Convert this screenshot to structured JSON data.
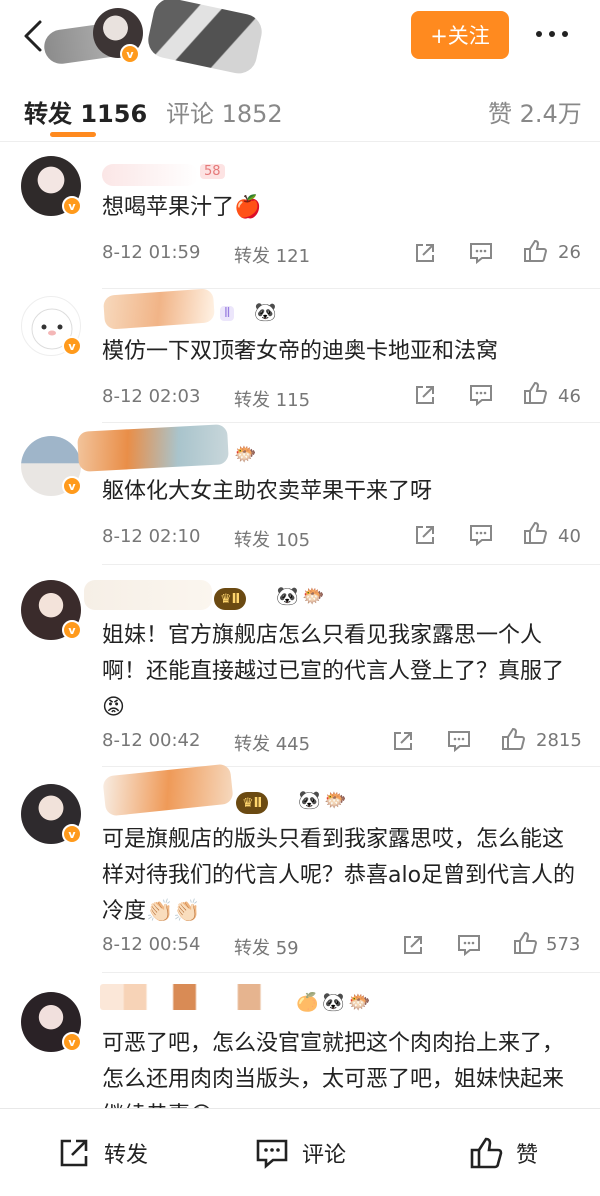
{
  "header": {
    "follow_label": "+关注"
  },
  "tabs": {
    "repost": "转发 1156",
    "comment": "评论 1852",
    "like": "赞 2.4万"
  },
  "comments": [
    {
      "badge": "58",
      "text": "想喝苹果汁了🍎",
      "time": "8-12 01:59",
      "repost": "转发 121",
      "likes": "26"
    },
    {
      "badge": "Ⅱ",
      "text": "模仿一下双顶奢女帝的迪奥卡地亚和法窝",
      "time": "8-12 02:03",
      "repost": "转发 115",
      "likes": "46"
    },
    {
      "text": "躯体化大女主助农卖苹果干来了呀",
      "time": "8-12 02:10",
      "repost": "转发 105",
      "likes": "40"
    },
    {
      "crown": "Ⅱ",
      "text": "姐妹！官方旗舰店怎么只看见我家露思一个人啊！还能直接越过已宣的代言人登上了？真服了😡",
      "time": "8-12 00:42",
      "repost": "转发 445",
      "likes": "2815"
    },
    {
      "crown": "Ⅱ",
      "text": "可是旗舰店的版头只看到我家露思哎，怎么能这样对待我们的代言人呢？恭喜alo足曾到代言人的冷度👏🏻👏🏻",
      "time": "8-12 00:54",
      "repost": "转发 59",
      "likes": "573"
    },
    {
      "text": "可恶了吧，怎么没官宣就把这个肉肉抬上来了，怎么还用肉肉当版头，太可恶了吧，姐妹快起来继续恭喜😡"
    }
  ],
  "bottom": {
    "repost": "转发",
    "comment": "评论",
    "like": "赞"
  },
  "colors": {
    "accent": "#ff8a1f",
    "verified": "#ff9a1c",
    "muted": "#777777"
  },
  "icons": [
    "back-arrow-icon",
    "more-dots-icon",
    "share-icon",
    "comment-icon",
    "like-icon",
    "verified-icon",
    "panda-icon",
    "fish-icon",
    "crown-icon"
  ]
}
